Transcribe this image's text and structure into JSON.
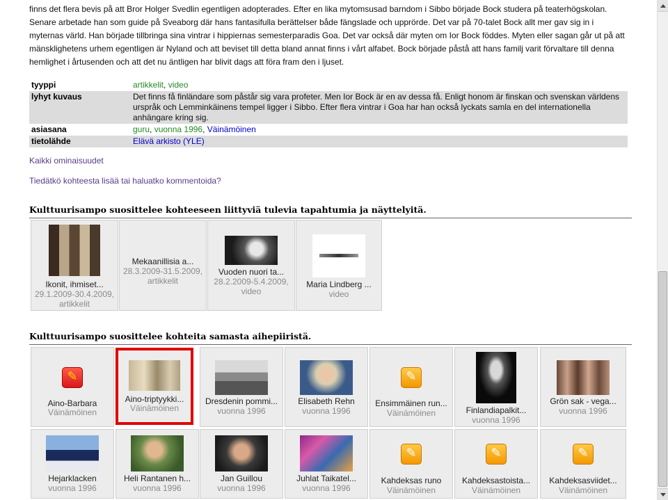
{
  "intro_text": "finns det flera bevis på att Bror Holger Svedlin egentligen adopterades. Efter en lika mytomsusad barndom i Sibbo började Bock studera på teaterhögskolan. Senare arbetade han som guide på Sveaborg där hans fantasifulla berättelser både fängslade och upprörde. Det var på 70-talet Bock allt mer gav sig in i myternas värld. Han började tillbringa sina vintrar i hippiernas semesterparadis Goa. Det var också där myten om Ior Bock föddes. Myten eller sagan går ut på att mänsklighetens urhem egentligen är Nyland och att beviset till detta bland annat finns i vårt alfabet. Bock började påstå att hans familj varit förvaltare till denna hemlighet i årtusenden och att det nu äntligen har blivit dags att föra fram den i ljuset.",
  "props": {
    "tyyppi_label": "tyyppi",
    "tyyppi_a": "artikkelit",
    "tyyppi_sep": ", ",
    "tyyppi_b": "video",
    "kuvaus_label": "lyhyt kuvaus",
    "kuvaus_value": "Det finns få finländare som påstår sig vara profeter. Men Ior Bock är en av dessa få. Enligt honom är finskan och svenskan världens urspråk och Lemminkäinens tempel ligger i Sibbo. Efter flera vintrar i Goa har han också lyckats samla en del internationella anhängare kring sig.",
    "asiasana_label": "asiasana",
    "asiasana_a": "guru",
    "asiasana_b": "vuonna 1996",
    "asiasana_c": "Väinämöinen",
    "tietolahde_label": "tietolähde",
    "tietolahde_value": "Elävä arkisto (YLE)"
  },
  "links": {
    "all_properties": "Kaikki ominaisuudet",
    "comment": "Tiedätkö kohteesta lisää tai haluatko kommentoida?"
  },
  "section1": {
    "heading": "Kulttuurisampo suosittelee kohteeseen liittyviä tulevia tapahtumia ja näyttelyitä.",
    "cards": [
      {
        "title": "Ikonit, ihmiset...",
        "sub": "29.1.2009-30.4.2009, artikkelit"
      },
      {
        "title": "Mekaanillisia a...",
        "sub": "28.3.2009-31.5.2009, artikkelit"
      },
      {
        "title": "Vuoden nuori ta...",
        "sub": "28.2.2009-5.4.2009, video"
      },
      {
        "title": "Maria Lindberg ...",
        "sub": "video"
      }
    ]
  },
  "section2": {
    "heading": "Kulttuurisampo suosittelee kohteita samasta aihepiiristä.",
    "row1": [
      {
        "title": "Aino-Barbara",
        "sub": "Väinämöinen",
        "icon": "palette-icon"
      },
      {
        "title": "Aino-triptyykki...",
        "sub": "Väinämöinen"
      },
      {
        "title": "Dresdenin pommi...",
        "sub": "vuonna 1996"
      },
      {
        "title": "Elisabeth Rehn",
        "sub": "vuonna 1996"
      },
      {
        "title": "Ensimmäinen run...",
        "sub": "Väinämöinen",
        "icon": "pencil-icon"
      },
      {
        "title": "Finlandiapalkit...",
        "sub": "vuonna 1996"
      },
      {
        "title": "Grön sak - vega...",
        "sub": "vuonna 1996"
      }
    ],
    "row2": [
      {
        "title": "Hejarklacken",
        "sub": "vuonna 1996"
      },
      {
        "title": "Heli Rantanen h...",
        "sub": "vuonna 1996"
      },
      {
        "title": "Jan Guillou",
        "sub": "vuonna 1996"
      },
      {
        "title": "Juhlat Taikatel...",
        "sub": "vuonna 1996"
      },
      {
        "title": "Kahdeksas runo",
        "sub": "Väinämöinen",
        "icon": "pencil-icon"
      },
      {
        "title": "Kahdeksastoista...",
        "sub": "Väinämöinen",
        "icon": "pencil-icon"
      },
      {
        "title": "Kahdeksasviidet...",
        "sub": "Väinämöinen",
        "icon": "pencil-icon"
      }
    ]
  },
  "colors": {
    "highlight": "#e00000",
    "link_green": "#228b22",
    "link_blue": "#0000cc",
    "card_bg": "#ececec"
  }
}
